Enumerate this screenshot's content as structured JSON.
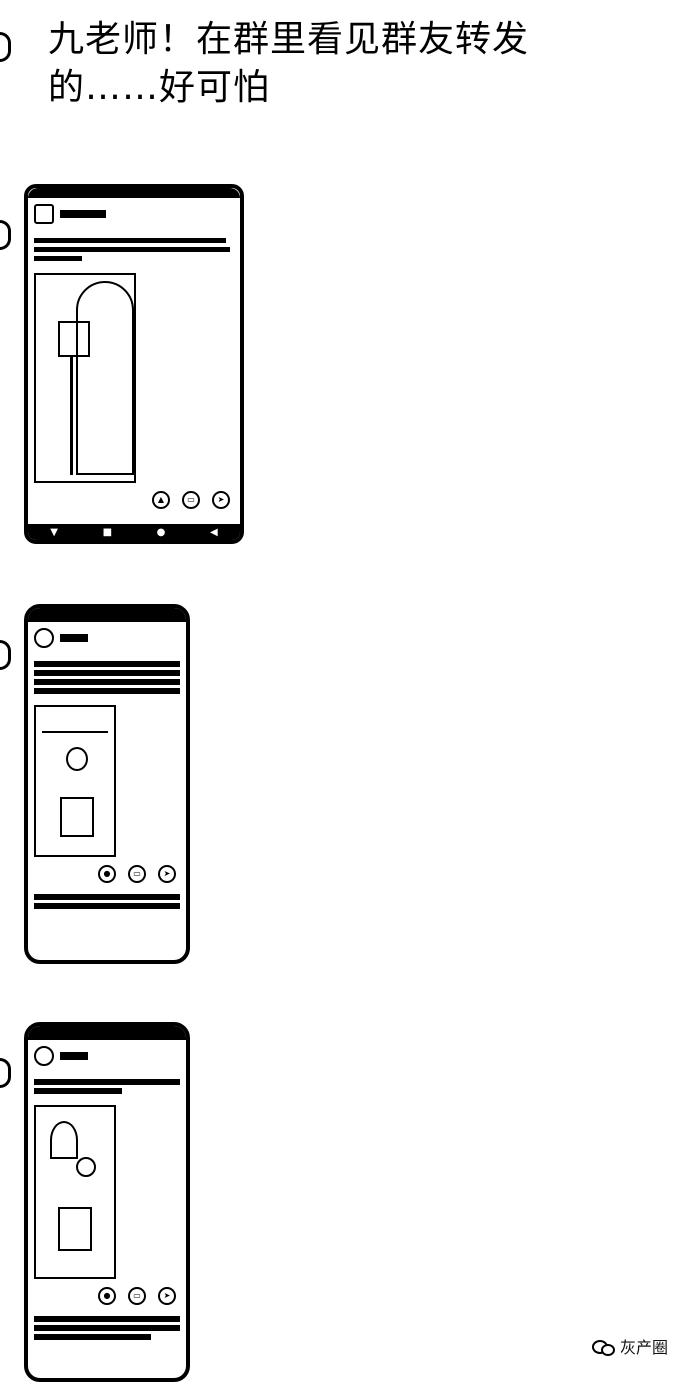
{
  "post": {
    "title": "九老师！在群里看见群友转发\n的……好可怕"
  },
  "watermark": {
    "label": "灰产圈",
    "icon": "wechat-icon"
  }
}
